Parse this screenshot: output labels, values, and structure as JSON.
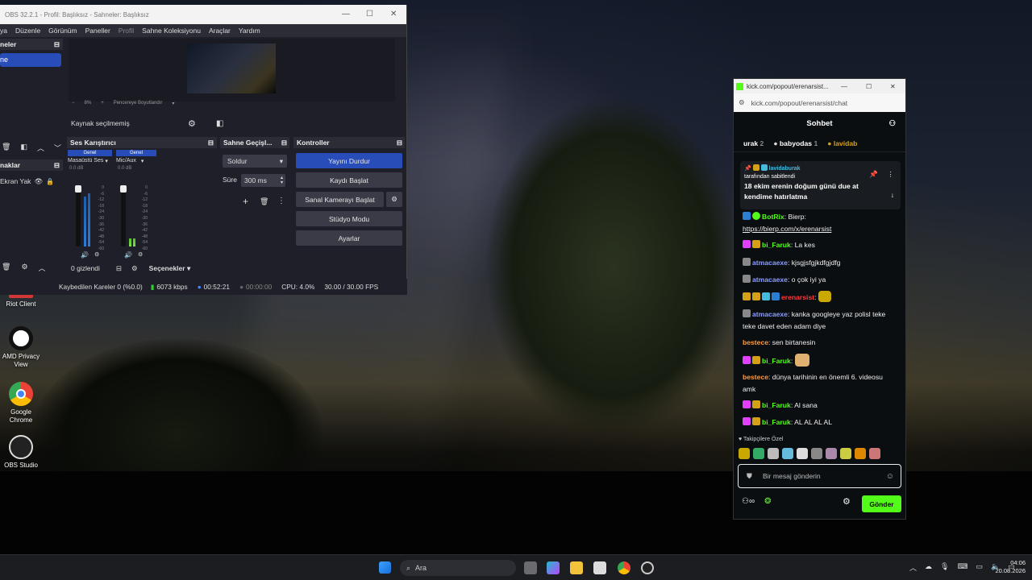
{
  "desktop_icons": [
    {
      "label": "Riot Client",
      "icon": "riot-icon"
    },
    {
      "label": "AMD Privacy View",
      "icon": "amd-privacy-icon"
    },
    {
      "label": "Google Chrome",
      "icon": "chrome-icon"
    },
    {
      "label": "OBS Studio",
      "icon": "obs-icon"
    }
  ],
  "obs": {
    "title": "OBS 32.2.1 - Profil: Başlıksız - Sahneler: Başlıksız",
    "menu": [
      "ya",
      "Düzenle",
      "Görünüm",
      "Paneller",
      "Profil",
      "Sahne Koleksiyonu",
      "Araçlar",
      "Yardım"
    ],
    "scenes_header": "neler",
    "scene_item": "ne",
    "zoom": "8%",
    "resize_label": "Pencereye Boyutlandır",
    "no_source": "Kaynak seçilmemiş",
    "sources_header": "naklar",
    "source_item": "Ekran Yak",
    "mixer_header": "Ses Karıştırıcı",
    "mixer_channels": [
      {
        "tag": "Genel",
        "name": "Masaüstü Ses",
        "db": "0.0 dB"
      },
      {
        "tag": "Genel",
        "name": "Mic/Aux",
        "db": "0.0 dB"
      }
    ],
    "meter_scale": [
      "0",
      "-6",
      "-12",
      "-18",
      "-24",
      "-30",
      "-36",
      "-42",
      "-48",
      "-54",
      "-60"
    ],
    "hidden_count": "0 gizlendi",
    "options_label": "Seçenekler",
    "transitions_header": "Sahne Geçişl...",
    "transition_type": "Soldur",
    "duration_label": "Süre",
    "duration_value": "300 ms",
    "controls_header": "Kontroller",
    "controls": [
      "Yayını Durdur",
      "Kaydı Başlat",
      "Sanal Kamerayı Başlat",
      "Stüdyo Modu",
      "Ayarlar"
    ],
    "status": {
      "dropped": "Kaybedilen Kareler 0 (%0.0)",
      "bitrate": "6073 kbps",
      "live_time": "00:52:21",
      "rec_time": "00:00:00",
      "cpu": "CPU: 4.0%",
      "fps": "30.00 / 30.00 FPS"
    }
  },
  "kick": {
    "tab_title": "kick.com/popout/erenarsist...",
    "url": "kick.com/popout/erenarsist/chat",
    "header": "Sohbet",
    "top_gifters": [
      {
        "name": "urak",
        "count": "2"
      },
      {
        "name": "babyodas",
        "count": "1"
      },
      {
        "name": "lavidab",
        "count": ""
      }
    ],
    "pinned": {
      "author": "lavidaburak",
      "by": "tarafından sabitlendi",
      "text": "18 ekim erenin doğum günü due at kendime hatırlatma"
    },
    "messages": [
      {
        "user": "BotRix",
        "color": "#53fc18",
        "text": "Bierp:",
        "link": "https://bierp.com/x/erenarsist"
      },
      {
        "user": "bi_Faruk",
        "color": "#53fc18",
        "text": "La kes"
      },
      {
        "user": "atmacaexe",
        "color": "#8b9dff",
        "text": "kjsgjsfgjkdfgjdfg"
      },
      {
        "user": "atmacaexe",
        "color": "#8b9dff",
        "text": "o çok iyi ya"
      },
      {
        "user": "erenarsist",
        "color": "#ff3b3b",
        "text": ""
      },
      {
        "user": "atmacaexe",
        "color": "#8b9dff",
        "text": "kanka googleye yaz polisl teke teke davet eden adam diye"
      },
      {
        "user": "bestece",
        "color": "#ff9a3c",
        "text": "sen birtanesin"
      },
      {
        "user": "bi_Faruk",
        "color": "#53fc18",
        "text": ""
      },
      {
        "user": "bestece",
        "color": "#ff9a3c",
        "text": "dünya tarihinin en önemli 6. videosu amk"
      },
      {
        "user": "bi_Faruk",
        "color": "#53fc18",
        "text": "Al sana"
      },
      {
        "user": "bi_Faruk",
        "color": "#53fc18",
        "text": "AL AL AL AL"
      }
    ],
    "followers_label": "Takipçilere Özel",
    "input_placeholder": "Bir mesaj gönderin",
    "send_label": "Gönder"
  },
  "taskbar": {
    "search_placeholder": "Ara",
    "time": "04:06",
    "date": "20.08.2026"
  },
  "colors": {
    "kick_green": "#53fc18",
    "obs_blue": "#284cb8"
  }
}
